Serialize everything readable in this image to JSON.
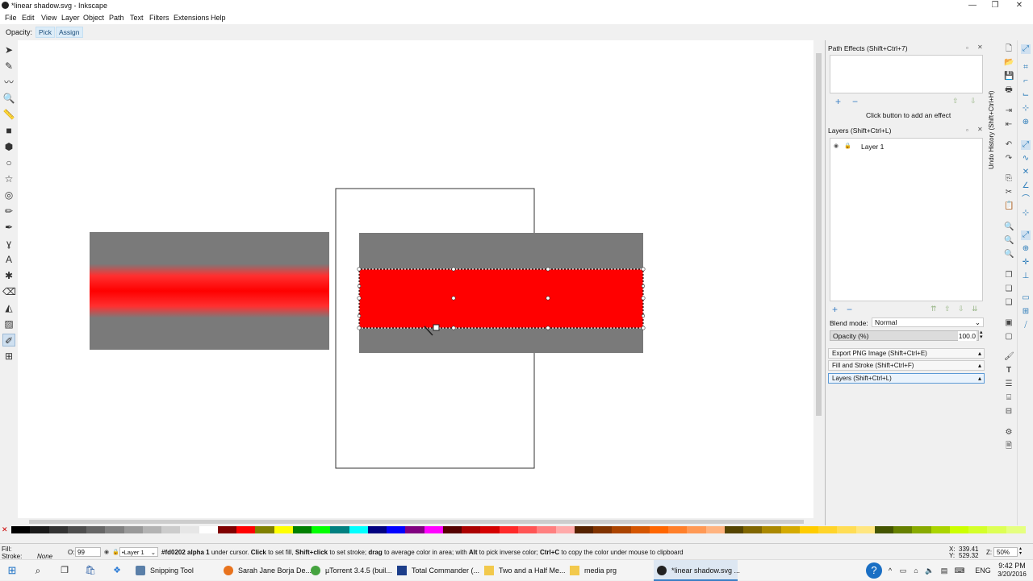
{
  "window": {
    "title": "*linear shadow.svg - Inkscape",
    "buttons": [
      "—",
      "❐",
      "✕"
    ]
  },
  "menu": [
    "File",
    "Edit",
    "View",
    "Layer",
    "Object",
    "Path",
    "Text",
    "Filters",
    "Extensions",
    "Help"
  ],
  "tool_controls": {
    "label": "Opacity:",
    "buttons": [
      "Pick",
      "Assign"
    ]
  },
  "tools": [
    {
      "name": "selector-tool-icon",
      "glyph": "➤"
    },
    {
      "name": "node-tool-icon",
      "glyph": "✎"
    },
    {
      "name": "tweak-tool-icon",
      "glyph": "〰"
    },
    {
      "name": "zoom-tool-icon",
      "glyph": "🔍"
    },
    {
      "name": "measure-tool-icon",
      "glyph": "📏"
    },
    {
      "name": "rectangle-tool-icon",
      "glyph": "■"
    },
    {
      "name": "3d-box-tool-icon",
      "glyph": "⬢"
    },
    {
      "name": "ellipse-tool-icon",
      "glyph": "○"
    },
    {
      "name": "star-tool-icon",
      "glyph": "☆"
    },
    {
      "name": "spiral-tool-icon",
      "glyph": "◎"
    },
    {
      "name": "pencil-tool-icon",
      "glyph": "✏"
    },
    {
      "name": "pen-tool-icon",
      "glyph": "✒"
    },
    {
      "name": "calligraphy-tool-icon",
      "glyph": "ɣ"
    },
    {
      "name": "text-tool-icon",
      "glyph": "A"
    },
    {
      "name": "spray-tool-icon",
      "glyph": "✱"
    },
    {
      "name": "eraser-tool-icon",
      "glyph": "⌫"
    },
    {
      "name": "paint-bucket-tool-icon",
      "glyph": "◭"
    },
    {
      "name": "gradient-tool-icon",
      "glyph": "▨"
    },
    {
      "name": "dropper-tool-icon",
      "glyph": "✐"
    },
    {
      "name": "connector-tool-icon",
      "glyph": "⊞"
    }
  ],
  "dock": {
    "path_effects": {
      "title": "Path Effects  (Shift+Ctrl+7)",
      "hint": "Click button to add an effect"
    },
    "layers": {
      "title": "Layers (Shift+Ctrl+L)",
      "layer_name": "Layer 1",
      "blend_label": "Blend mode:",
      "blend_value": "Normal",
      "opacity_label": "Opacity (%)",
      "opacity_value": "100.0"
    },
    "tabs": [
      "Export PNG Image (Shift+Ctrl+E)",
      "Fill and Stroke (Shift+Ctrl+F)",
      "Layers (Shift+Ctrl+L)"
    ],
    "undo_history_label": "Undo History (Shift+Ctrl+H)"
  },
  "colors": {
    "red": "#ff0000",
    "gray": "#7a7a7a",
    "accent": "#3b7fc4",
    "palette": [
      "#000000",
      "#1a1a1a",
      "#333333",
      "#4d4d4d",
      "#666666",
      "#808080",
      "#999999",
      "#b3b3b3",
      "#cccccc",
      "#e6e6e6",
      "#ffffff",
      "#800000",
      "#ff0000",
      "#808000",
      "#ffff00",
      "#008000",
      "#00ff00",
      "#008080",
      "#00ffff",
      "#000080",
      "#0000ff",
      "#800080",
      "#ff00ff",
      "#550000",
      "#aa0000",
      "#d40000",
      "#ff2a2a",
      "#ff5555",
      "#ff8080",
      "#ffaaaa",
      "#552200",
      "#803300",
      "#aa4400",
      "#d45500",
      "#ff6600",
      "#ff7f2a",
      "#ff9955",
      "#ffb380",
      "#554400",
      "#806600",
      "#aa8800",
      "#d4aa00",
      "#ffcc00",
      "#ffd42a",
      "#ffdd55",
      "#ffe680",
      "#445500",
      "#668000",
      "#88aa00",
      "#aad400",
      "#ccff00",
      "#d4ff2a",
      "#ddff55",
      "#e5ff80"
    ]
  },
  "status": {
    "fill_label": "Fill:",
    "stroke_label": "Stroke:",
    "stroke_value": "None",
    "opacity_label": "O:",
    "opacity_value": "99",
    "layer_value": "•Layer 1",
    "message_color": "#fd0202 alpha 1",
    "message_rest_1": " under cursor. ",
    "msg_click": "Click",
    "msg_2": " to set fill, ",
    "msg_shift": "Shift+click",
    "msg_3": " to set stroke; ",
    "msg_drag": "drag",
    "msg_4": " to average color in area; with ",
    "msg_alt": "Alt",
    "msg_5": " to pick inverse color; ",
    "msg_ctrl": "Ctrl+C",
    "msg_6": " to copy the color under mouse to clipboard",
    "x_label": "X:",
    "x_value": "339.41",
    "y_label": "Y:",
    "y_value": "529.32",
    "z_label": "Z:",
    "z_value": "50%"
  },
  "taskbar": {
    "items": [
      {
        "label": "Snipping Tool"
      },
      {
        "label": "Sarah Jane Borja De..."
      },
      {
        "label": "µTorrent 3.4.5  (buil..."
      },
      {
        "label": "Total Commander (..."
      },
      {
        "label": "Two and a Half Me..."
      },
      {
        "label": "media prg"
      },
      {
        "label": "*linear shadow.svg ..."
      }
    ],
    "language": "ENG",
    "time": "9:42 PM",
    "date": "3/20/2016"
  }
}
